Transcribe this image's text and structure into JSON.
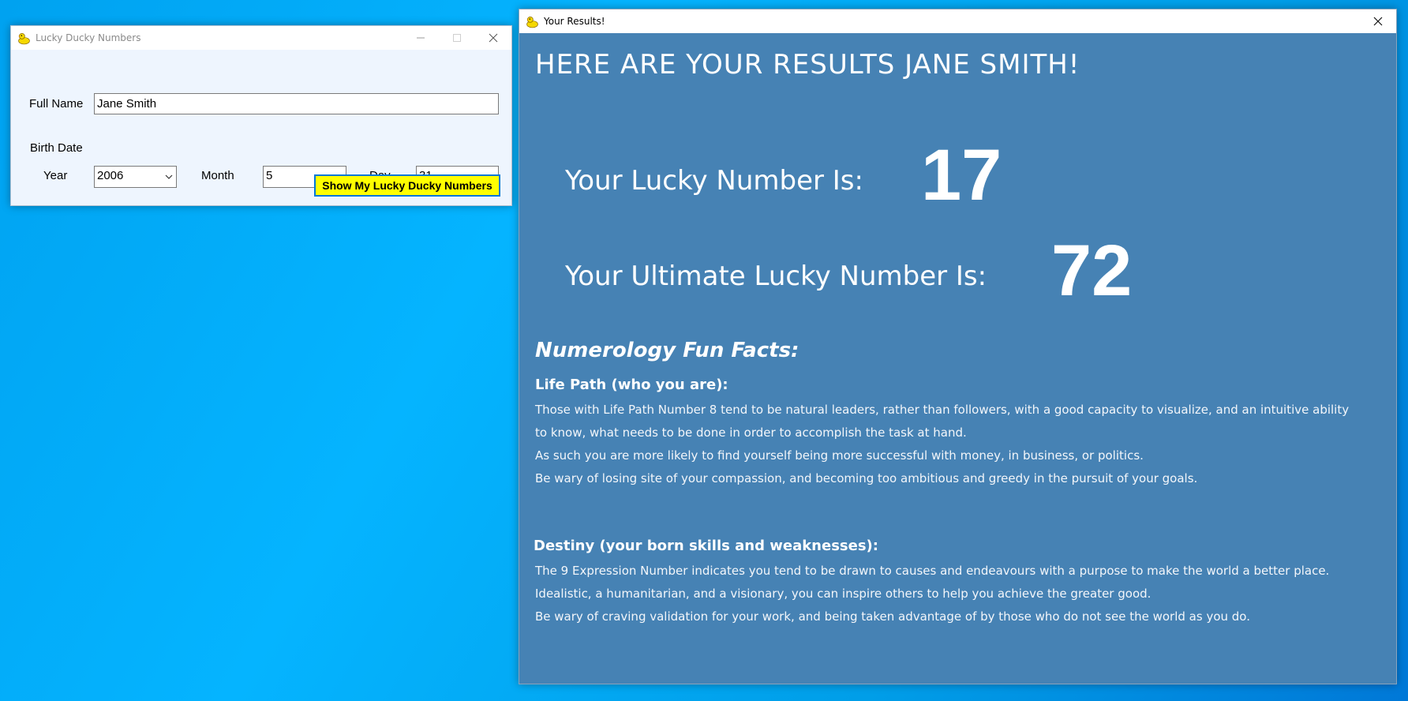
{
  "form_window": {
    "title": "Lucky Ducky Numbers",
    "full_name_label": "Full Name",
    "full_name_value": "Jane Smith",
    "birth_date_label": "Birth Date",
    "year_label": "Year",
    "year_value": "2006",
    "month_label": "Month",
    "month_value": "5",
    "day_label": "Day",
    "day_value": "31",
    "button_label": "Show My Lucky Ducky Numbers"
  },
  "results_window": {
    "title": "Your Results!",
    "heading": "HERE ARE YOUR RESULTS JANE SMITH!",
    "lucky_label": "Your Lucky Number Is:",
    "lucky_number": "17",
    "ultimate_label": "Your Ultimate Lucky Number Is:",
    "ultimate_number": "72",
    "facts_heading": "Numerology Fun Facts:",
    "life_path": {
      "heading": "Life Path (who you are):",
      "lines": [
        "Those with Life Path Number 8 tend to be natural leaders, rather than followers, with a good capacity to visualize, and an intuitive ability",
        "to know, what needs to be done in order to accomplish the task at hand.",
        "As such you are more likely to find yourself being more successful with money, in business, or politics.",
        "Be wary of losing site of your compassion, and becoming too ambitious and greedy in the pursuit of your goals."
      ]
    },
    "destiny": {
      "heading": "Destiny (your born skills and weaknesses):",
      "lines": [
        "The 9 Expression Number indicates you tend to be drawn to causes and endeavours with a purpose to make the world a better place.",
        "Idealistic, a humanitarian, and a visionary, you can inspire others to help you achieve the greater good.",
        "Be wary of craving validation for your work, and being taken advantage of by those who do not see the world as you do."
      ]
    }
  },
  "colors": {
    "results_background": "#4682b4",
    "button_background": "#ffff00",
    "button_border": "#0078d7"
  }
}
